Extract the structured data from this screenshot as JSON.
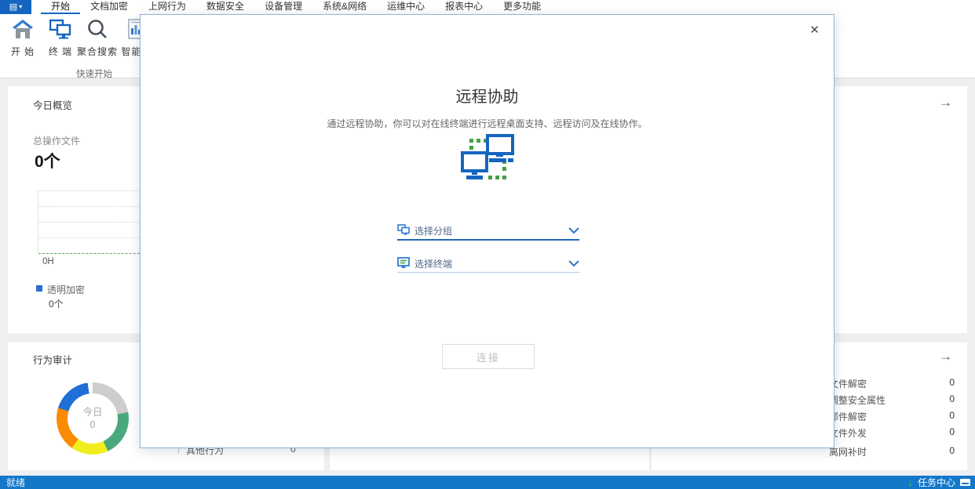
{
  "colors": {
    "app_button": "#1565c0",
    "accent_blue": "#2268b4",
    "statusbar": "#1377ca",
    "icon_blue": "#1565c0",
    "dot_green": "#43a047",
    "legend_blue": "#2a6ed3",
    "chart_baseline_green": "#5aa95a",
    "disabled_text": "#c0c0c0"
  },
  "icons": {
    "app_glyph": "▤",
    "caret_down": "▾",
    "forward_arrow": "→",
    "close": "✕",
    "download_arrow": "↓"
  },
  "menubar": {
    "items": [
      {
        "label": "开始",
        "active": true
      },
      {
        "label": "文档加密"
      },
      {
        "label": "上网行为"
      },
      {
        "label": "数据安全"
      },
      {
        "label": "设备管理"
      },
      {
        "label": "系统&网络"
      },
      {
        "label": "运维中心"
      },
      {
        "label": "报表中心"
      },
      {
        "label": "更多功能"
      }
    ]
  },
  "ribbon": {
    "buttons": [
      {
        "label": "开 始",
        "icon": "home-icon"
      },
      {
        "label": "终 端",
        "icon": "terminals-icon"
      },
      {
        "label": "聚合搜索",
        "icon": "search-icon"
      },
      {
        "label": "智能报",
        "icon": "report-icon"
      }
    ],
    "group_label": "快速开始"
  },
  "dashboard": {
    "overview_card": {
      "title": "今日概览",
      "metric_label": "总操作文件",
      "metric_value": "0个",
      "axis_label": "0H",
      "legend_label": "透明加密",
      "legend_value": "0个"
    },
    "audit_card": {
      "title": "行为审计",
      "donut_center_label": "今日",
      "donut_center_value": "0"
    },
    "middle_partial_row": {
      "label": "其他行为",
      "value": "0"
    },
    "right_list": [
      {
        "label": "文件解密",
        "value": "0"
      },
      {
        "label": "调整安全属性",
        "value": "0"
      },
      {
        "label": "邮件解密",
        "value": "0"
      },
      {
        "label": "文件外发",
        "value": "0"
      },
      {
        "label": "离网补时",
        "value": "0"
      }
    ]
  },
  "modal": {
    "title": "远程协助",
    "description": "通过远程协助，你可以对在线终端进行远程桌面支持、远程访问及在线协作。",
    "group_select_placeholder": "选择分组",
    "terminal_select_placeholder": "选择终端",
    "connect_label": "连接"
  },
  "statusbar": {
    "ready": "就绪",
    "task_center": "任务中心"
  },
  "chart_data": {
    "type": "pie",
    "title": "行为审计",
    "center_label": "今日",
    "center_value": 0,
    "note": "donut ring, all counts 0; empty line chart in 今日概览 with baseline 0H",
    "segments": [
      {
        "name": "segment-gray",
        "color": "#cdcdcd",
        "from": 0,
        "to": 80
      },
      {
        "name": "segment-green",
        "color": "#4aa97c",
        "from": 80,
        "to": 155
      },
      {
        "name": "segment-yellow",
        "color": "#f0ee1e",
        "from": 155,
        "to": 215
      },
      {
        "name": "segment-orange",
        "color": "#fb8b00",
        "from": 215,
        "to": 287
      },
      {
        "name": "segment-blue",
        "color": "#1f6fd6",
        "from": 287,
        "to": 352
      }
    ]
  }
}
